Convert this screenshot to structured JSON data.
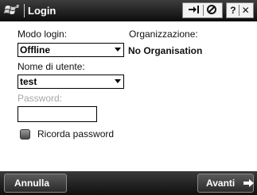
{
  "window": {
    "title": "Login"
  },
  "form": {
    "login_mode_label": "Modo login:",
    "login_mode_value": "Offline",
    "organization_label": "Organizzazione:",
    "organization_value": "No Organisation",
    "username_label": "Nome di utente:",
    "username_value": "test",
    "password_label": "Password:",
    "password_value": "",
    "remember_label": "Ricorda password",
    "remember_checked": false
  },
  "softkeys": {
    "left": "Annulla",
    "right": "Avanti"
  },
  "icons": {
    "start": "windows-flag-icon",
    "connectivity": "connectivity-icon",
    "volume": "volume-icon",
    "help": "help-icon",
    "close": "close-icon",
    "next": "arrow-right-icon"
  },
  "colors": {
    "titlebar": "#1f1f1f",
    "disabled_text": "#a7a7a7"
  }
}
